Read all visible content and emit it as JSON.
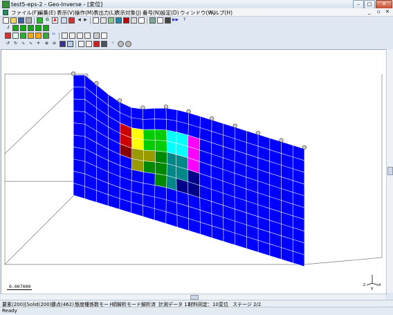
{
  "window": {
    "title": "test5-eps-2 - Geo-Inverse - [変位]",
    "buttons": {
      "minimize": "–",
      "maximize": "□",
      "close": "✕"
    }
  },
  "menu": {
    "items": [
      "ファイル(F)",
      "編集(E)",
      "表示(V)",
      "操作(M)",
      "表出力(L)",
      "表示対象(J)",
      "番号(N)",
      "設定(D)",
      "ウィンドウ(W)",
      "ヘルプ(H)"
    ],
    "mdi_controls": {
      "minimize": "_",
      "restore": "▫",
      "close": "✕"
    }
  },
  "toolbar": {
    "icons": [
      "new-icon",
      "open-icon",
      "save-icon",
      "print-icon",
      "run-icon",
      "g-icon",
      "text-a-icon",
      "pointer-icon",
      "arrow-left-icon",
      "arrow-right-icon",
      "frame-icon",
      "grid-icon",
      "edit-icon",
      "blue-square-icon",
      "red-square-icon",
      "settings-icon",
      "chart-icon",
      "window-icon",
      "forward-icon",
      "help-cursor-icon"
    ],
    "text_a_label": "A",
    "g_label": "G"
  },
  "view": {
    "scale_value": "0.007000",
    "axis_labels": {
      "z": "z",
      "y": "y",
      "x": "x"
    },
    "colors": {
      "mesh_blue": "#0000ff",
      "red": "#cc0000",
      "dark_red": "#880000",
      "yellow": "#ffff00",
      "olive": "#999900",
      "green": "#00cc00",
      "dark_green": "#008800",
      "cyan": "#00ffff",
      "teal": "#008888",
      "magenta": "#ff00ff",
      "navy": "#000088",
      "grid_line": "#ffffff"
    }
  },
  "info": {
    "elements": "要素(200)[Solid(200) ]",
    "nodes": "節点(462)",
    "mode1": "態度種係数モード",
    "mode2": "順解析モード",
    "mode3": "解析済",
    "measure": "計測データ 11",
    "material": "材料同定：10",
    "display": "変位",
    "stage": "ステージ 2/2"
  },
  "status": {
    "text": "Ready"
  }
}
